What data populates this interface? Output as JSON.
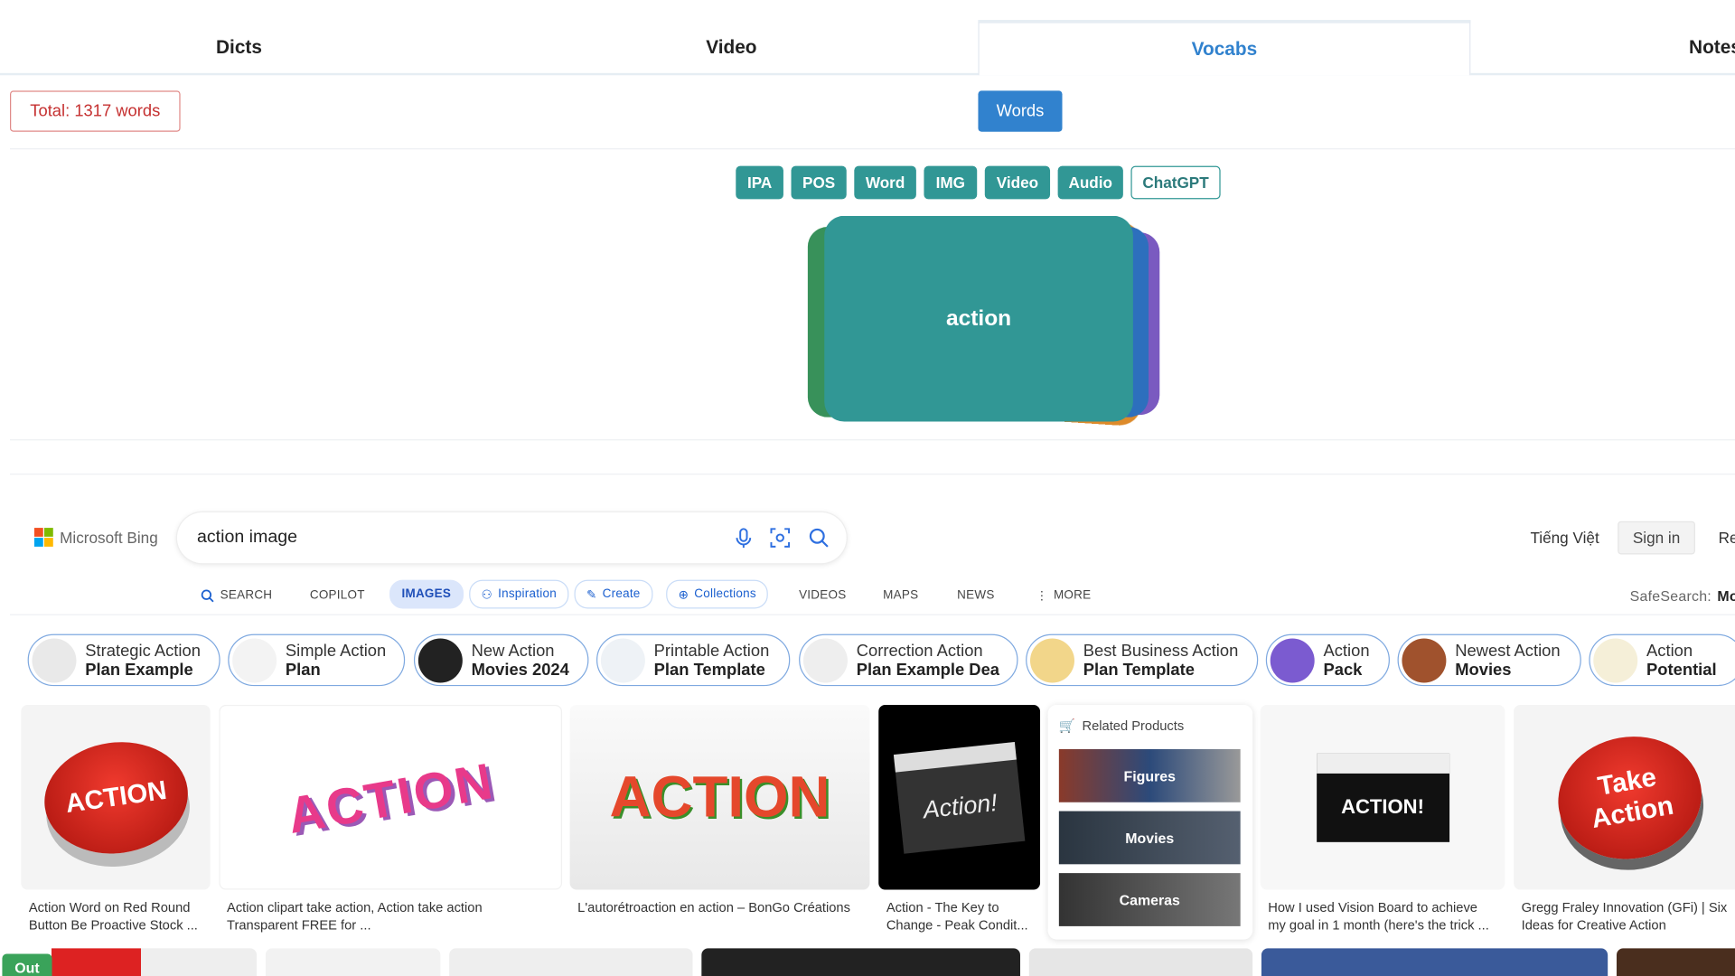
{
  "tabs": [
    {
      "label": "Dicts"
    },
    {
      "label": "Video"
    },
    {
      "label": "Vocabs",
      "active": true
    },
    {
      "label": "Notes"
    }
  ],
  "vocab": {
    "total": "Total: 1317 words",
    "words_button": "Words",
    "chips": [
      {
        "label": "IPA"
      },
      {
        "label": "POS"
      },
      {
        "label": "Word"
      },
      {
        "label": "IMG"
      },
      {
        "label": "Video"
      },
      {
        "label": "Audio"
      },
      {
        "label": "ChatGPT",
        "outlined": true
      }
    ],
    "card_word": "action",
    "accent": "#319795"
  },
  "bing": {
    "logo": "Microsoft Bing",
    "query": "action image",
    "language": "Tiếng Việt",
    "sign_in": "Sign in",
    "rewards": "Re",
    "nav": {
      "search": "SEARCH",
      "copilot": "COPILOT",
      "images": "IMAGES",
      "inspiration": "Inspiration",
      "create": "Create",
      "collections": "Collections",
      "videos": "VIDEOS",
      "maps": "MAPS",
      "news": "NEWS",
      "more": "MORE",
      "safesearch": "SafeSearch:",
      "safesearch_value": "Mo"
    },
    "related": [
      {
        "line1": "Strategic Action",
        "line2": "Plan Example"
      },
      {
        "line1": "Simple Action",
        "line2": "Plan"
      },
      {
        "line1": "New Action",
        "line2": "Movies 2024"
      },
      {
        "line1": "Printable Action",
        "line2": "Plan Template"
      },
      {
        "line1": "Correction Action",
        "line2": "Plan Example Dea"
      },
      {
        "line1": "Best Business Action",
        "line2": "Plan Template"
      },
      {
        "line1": "Action",
        "line2": "Pack"
      },
      {
        "line1": "Newest Action",
        "line2": "Movies"
      },
      {
        "line1": "Action",
        "line2": "Potential"
      }
    ],
    "images": [
      {
        "caption1": "Action Word on Red Round",
        "caption2": "Button Be Proactive Stock ...",
        "art": "ACTION"
      },
      {
        "caption1": "Action clipart take action, Action take action",
        "caption2": "Transparent FREE for ...",
        "art": "ACTION"
      },
      {
        "caption1": "L'autorétroaction en action – BonGo Créations",
        "caption2": "",
        "art": "ACTION"
      },
      {
        "caption1": "Action - The Key to",
        "caption2": "Change - Peak Condit...",
        "art": "Action!"
      },
      {
        "caption1": "How I used Vision Board to achieve",
        "caption2": "my goal in 1 month (here's the trick ...",
        "art": "ACTION!"
      },
      {
        "caption1": "Gregg Fraley Innovation (GFi) | Six",
        "caption2": "Ideas for Creative Action",
        "art": "Take Action"
      }
    ],
    "related_products": {
      "title": "Related Products",
      "items": [
        "Figures",
        "Movies",
        "Cameras"
      ]
    },
    "badge": "Out"
  }
}
